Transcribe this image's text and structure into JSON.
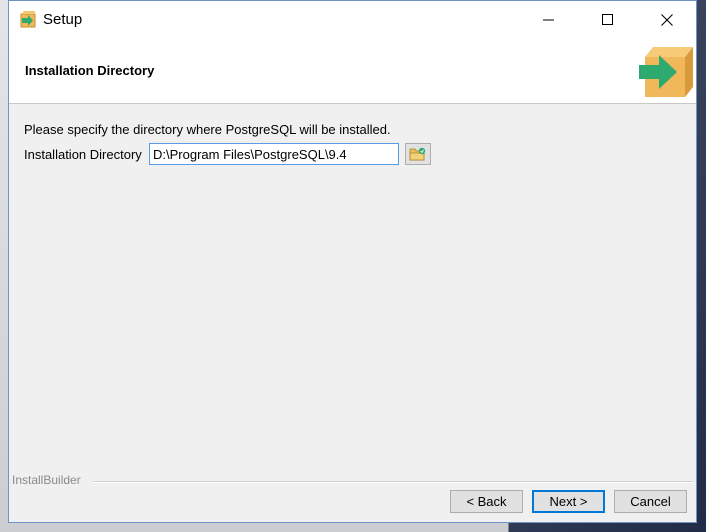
{
  "window": {
    "title": "Setup",
    "minimize_icon": "minimize-icon",
    "maximize_icon": "maximize-icon",
    "close_icon": "close-icon"
  },
  "header": {
    "title": "Installation Directory",
    "logo_icon": "installer-box-arrow-icon"
  },
  "content": {
    "instruction": "Please specify the directory where PostgreSQL will be installed.",
    "directory_label": "Installation Directory",
    "directory_value": "D:\\Program Files\\PostgreSQL\\9.4",
    "browse_icon": "folder-browse-icon"
  },
  "footer": {
    "brand": "InstallBuilder",
    "back_label": "< Back",
    "next_label": "Next >",
    "cancel_label": "Cancel"
  },
  "colors": {
    "window_border": "#6e94c8",
    "accent": "#0078d7",
    "logo_box": "#f0b85a",
    "logo_arrow": "#2eaa6e"
  }
}
